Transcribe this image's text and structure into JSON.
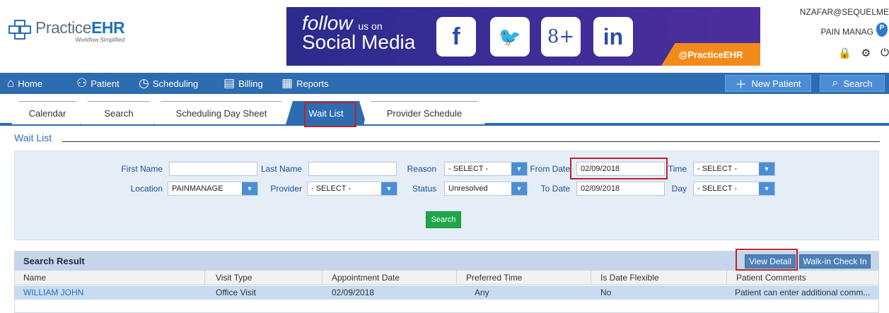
{
  "header": {
    "logo": {
      "name_plain": "Practice",
      "name_bold": "EHR",
      "tagline": "Workflow Simplified"
    },
    "banner": {
      "follow": "follow",
      "us_on": "us on",
      "social": "Social Media",
      "icons": [
        {
          "icon": "facebook-icon",
          "glyph": "f"
        },
        {
          "icon": "twitter-icon",
          "glyph": "🐦"
        },
        {
          "icon": "google-plus-icon",
          "glyph": "8+"
        },
        {
          "icon": "linkedin-icon",
          "glyph": "in"
        }
      ],
      "handle": "@PracticeEHR"
    },
    "user": {
      "email": "NZAFAR@SEQUELME",
      "practice": "PAIN MANAG",
      "pin_letter": "P"
    }
  },
  "nav": {
    "items": [
      {
        "label": "Home",
        "icon": "home-icon"
      },
      {
        "label": "Patient",
        "icon": "patient-icon"
      },
      {
        "label": "Scheduling",
        "icon": "clock-icon"
      },
      {
        "label": "Billing",
        "icon": "billing-icon"
      },
      {
        "label": "Reports",
        "icon": "calendar-icon"
      }
    ],
    "new_patient": "New Patient",
    "search": "Search"
  },
  "tabs": [
    "Calendar",
    "Search",
    "Scheduling Day Sheet",
    "Wait List",
    "Provider Schedule"
  ],
  "active_tab": "Wait List",
  "wait_list": {
    "title": "Wait List",
    "filters": {
      "first_name_label": "First Name",
      "first_name_value": "",
      "last_name_label": "Last Name",
      "last_name_value": "",
      "reason_label": "Reason",
      "reason_value": "- SELECT -",
      "from_date_label": "From Date",
      "from_date_value": "02/09/2018",
      "time_label": "Time",
      "time_value": "- SELECT -",
      "location_label": "Location",
      "location_value": "PAINMANAGE",
      "provider_label": "Provider",
      "provider_value": "- SELECT -",
      "status_label": "Status",
      "status_value": "Unresolved",
      "to_date_label": "To Date",
      "to_date_value": "02/09/2018",
      "day_label": "Day",
      "day_value": "- SELECT -"
    },
    "search_button": "Search"
  },
  "results": {
    "title": "Search Result",
    "view_detail": "View Detail",
    "walkin": "Walk-in Check In",
    "columns": [
      "Name",
      "Visit Type",
      "Appointment Date",
      "Preferred Time",
      "Is Date Flexible",
      "Patient Comments"
    ],
    "rows": [
      [
        "WILLIAM JOHN",
        "Office Visit",
        "02/09/2018",
        "Any",
        "No",
        "Patient can enter additional comm..."
      ]
    ]
  },
  "colors": {
    "nav_blue": "#2d6cb1",
    "accent_red": "#c0202b",
    "search_green": "#1fa64a",
    "handle_orange": "#f38b1a"
  }
}
